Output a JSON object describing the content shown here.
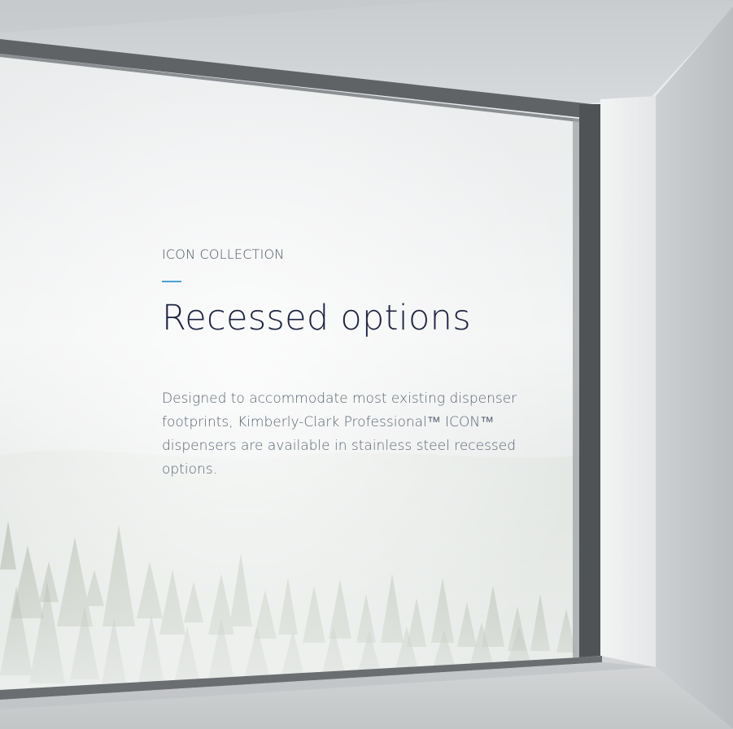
{
  "section": {
    "eyebrow": "ICON COLLECTION",
    "title": "Recessed options",
    "body": "Designed to accommodate most existing dispenser footprints, Kimberly-Clark Professional™ ICON™ dispensers are available in stainless steel recessed options."
  },
  "colors": {
    "accent": "#4f9fd6",
    "title": "#1d2240",
    "body": "#5a6470",
    "eyebrow": "#4b5560"
  }
}
